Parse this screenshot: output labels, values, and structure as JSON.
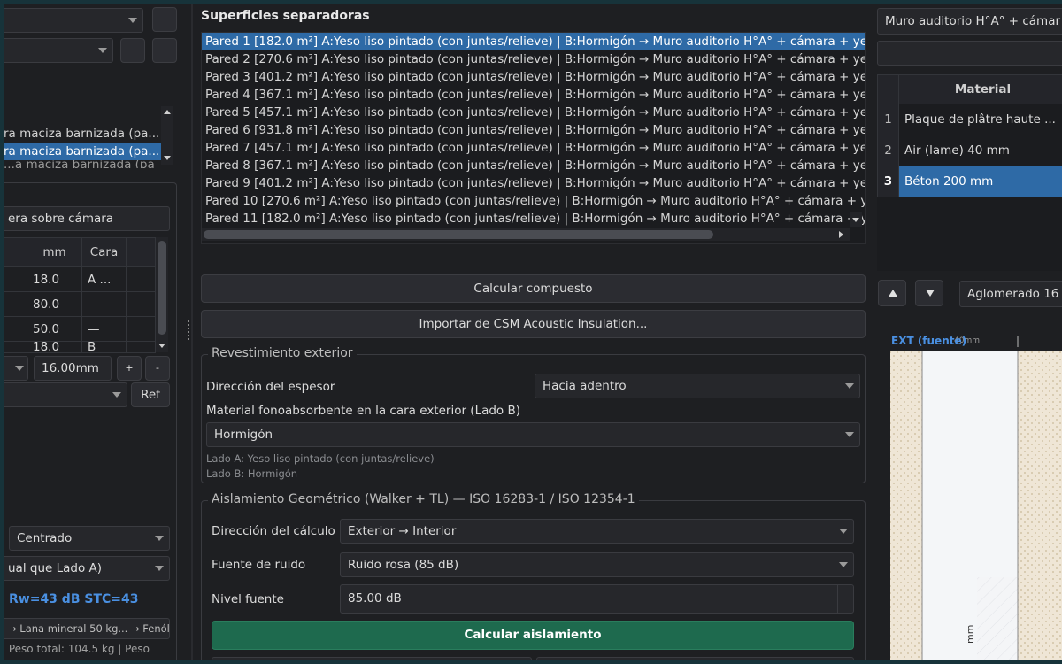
{
  "left": {
    "top_combo_1": "",
    "top_combo_2": "",
    "list_items": [
      "ra maciza barnizada (pa...",
      "ra maciza barnizada (pa...",
      "...a maciza barnizada (pa"
    ],
    "layer_name": "era sobre cámara",
    "table_headers": [
      "mm",
      "Cara"
    ],
    "table_rows": [
      {
        "mm": "18.0",
        "cara": "A ..."
      },
      {
        "mm": "80.0",
        "cara": "—"
      },
      {
        "mm": "50.0",
        "cara": "—"
      },
      {
        "mm": "18.0",
        "cara": "B"
      }
    ],
    "thickness": "16.00mm",
    "ref_button": "Ref",
    "plus_btn": "+",
    "minus_btn": "-",
    "alignment": "Centrado",
    "side_b": "ual que Lado A)",
    "result": "Rw=43 dB  STC=43",
    "layers_summary": "→ Lana mineral 50 kg... → Fenólic",
    "footer": "|  Peso total: 104.5 kg  |  Peso"
  },
  "center": {
    "title": "Superficies separadoras",
    "walls": [
      "Pared 1 [182.0 m²]  A:Yeso liso pintado (con juntas/relieve) | B:Hormigón → Muro auditorio H°A° + cámara + ye",
      "Pared 2 [270.6 m²]  A:Yeso liso pintado (con juntas/relieve) | B:Hormigón → Muro auditorio H°A° + cámara + ye",
      "Pared 3 [401.2 m²]  A:Yeso liso pintado (con juntas/relieve) | B:Hormigón → Muro auditorio H°A° + cámara + ye",
      "Pared 4 [367.1 m²]  A:Yeso liso pintado (con juntas/relieve) | B:Hormigón → Muro auditorio H°A° + cámara + ye",
      "Pared 5 [457.1 m²]  A:Yeso liso pintado (con juntas/relieve) | B:Hormigón → Muro auditorio H°A° + cámara + ye",
      "Pared 6 [931.8 m²]  A:Yeso liso pintado (con juntas/relieve) | B:Hormigón → Muro auditorio H°A° + cámara + ye",
      "Pared 7 [457.1 m²]  A:Yeso liso pintado (con juntas/relieve) | B:Hormigón → Muro auditorio H°A° + cámara + ye",
      "Pared 8 [367.1 m²]  A:Yeso liso pintado (con juntas/relieve) | B:Hormigón → Muro auditorio H°A° + cámara + ye",
      "Pared 9 [401.2 m²]  A:Yeso liso pintado (con juntas/relieve) | B:Hormigón → Muro auditorio H°A° + cámara + ye",
      "Pared 10 [270.6 m²]  A:Yeso liso pintado (con juntas/relieve) | B:Hormigón → Muro auditorio H°A° + cámara + y",
      "Pared 11 [182.0 m²]  A:Yeso liso pintado (con juntas/relieve) | B:Hormigón → Muro auditorio H°A° + cámara + y"
    ],
    "calc_composite": "Calcular compuesto",
    "import_csm": "Importar de CSM Acoustic Insulation...",
    "exterior_group": {
      "title": "Revestimiento exterior",
      "direction_label": "Dirección del espesor",
      "direction_value": "Hacia adentro",
      "absorb_label": "Material fonoabsorbente en la cara exterior (Lado B)",
      "absorb_value": "Hormigón",
      "side_a_note": "Lado A: Yeso liso pintado (con juntas/relieve)",
      "side_b_note": "Lado B: Hormigón"
    },
    "geo_group": {
      "title": "Aislamiento Geométrico (Walker + TL)  —  ISO 16283-1 / ISO 12354-1",
      "calc_dir_label": "Dirección del cálculo",
      "calc_dir_value": "Exterior → Interior",
      "noise_label": "Fuente de ruido",
      "noise_value": "Ruido rosa (85 dB)",
      "level_label": "Nivel fuente",
      "level_value": "85.00 dB",
      "calc_button": "Calcular aislamiento"
    }
  },
  "right": {
    "wall_combo": "Muro auditorio H°A° + cámar",
    "search": "",
    "table_header": "Material",
    "materials": [
      {
        "num": "1",
        "name": "Plaque de plâtre haute ..."
      },
      {
        "num": "2",
        "name": "Air (lame) 40 mm"
      },
      {
        "num": "3",
        "name": "Béton 200 mm"
      }
    ],
    "material_combo": "Aglomerado 16",
    "diagram_label": "EXT (fuente)",
    "dim_label": "40mm",
    "vertical_dim": "mm"
  },
  "colors": {
    "accent_blue": "#2e6aa6",
    "green_button": "#1e6a4e",
    "result_blue": "#4a90e2"
  }
}
